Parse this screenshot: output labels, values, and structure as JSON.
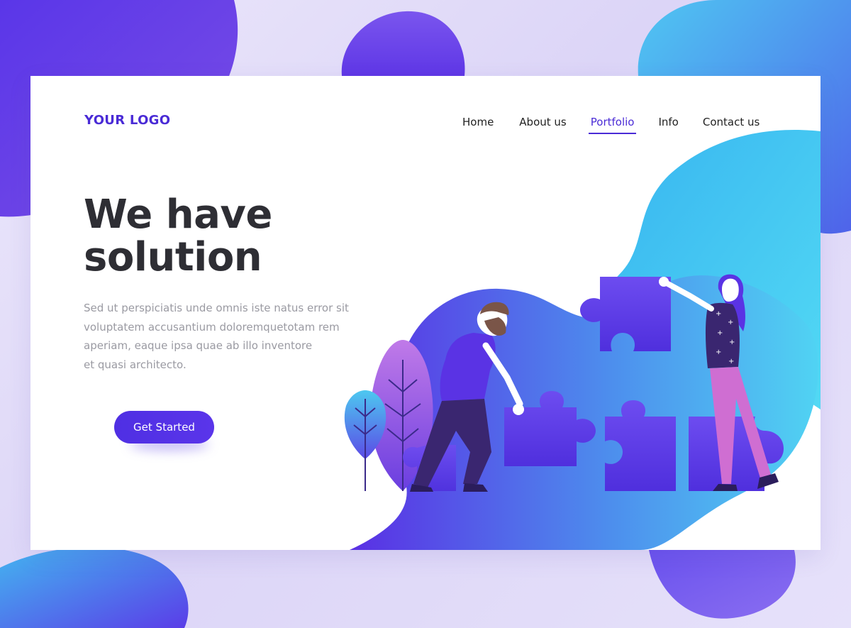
{
  "header": {
    "logo": "YOUR LOGO",
    "nav": [
      {
        "label": "Home",
        "active": false
      },
      {
        "label": "About us",
        "active": false
      },
      {
        "label": "Portfolio",
        "active": true
      },
      {
        "label": "Info",
        "active": false
      },
      {
        "label": "Contact us",
        "active": false
      }
    ]
  },
  "hero": {
    "headline_line1": "We have",
    "headline_line2": "solution",
    "body_lines": [
      "Sed ut perspiciatis unde omnis iste natus error sit",
      "voluptatem accusantium doloremquetotam rem",
      "aperiam, eaque ipsa quae ab illo inventore",
      "et quasi architecto."
    ],
    "cta_label": "Get Started"
  },
  "illustration": {
    "subject": "two people assembling puzzle pieces beside plants"
  },
  "colors": {
    "accent": "#4a2bd6",
    "button": "#5231e6",
    "heading": "#2e2e34",
    "body_text": "#9a9aa2",
    "gradient_cyan": "#4ed5f3",
    "gradient_purple": "#5b33e6"
  }
}
